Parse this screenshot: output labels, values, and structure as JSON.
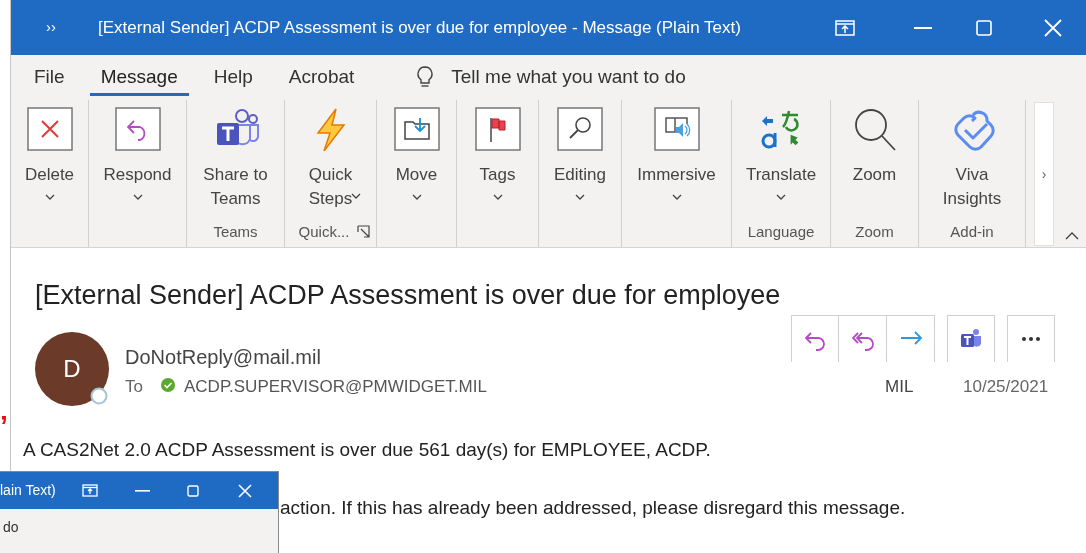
{
  "window": {
    "title": "[External Sender] ACDP Assessment is over due for employee  -  Message (Plain Text)",
    "overflow_glyph": "››"
  },
  "menu": [
    {
      "label": "File",
      "selected": false
    },
    {
      "label": "Message",
      "selected": true
    },
    {
      "label": "Help",
      "selected": false
    },
    {
      "label": "Acrobat",
      "selected": false
    }
  ],
  "tell_me": {
    "placeholder": "Tell me what you want to do"
  },
  "ribbon": {
    "groups": [
      {
        "buttons": [
          {
            "kind": "delete",
            "label": "Delete",
            "dropdown": true
          }
        ]
      },
      {
        "buttons": [
          {
            "kind": "respond",
            "label": "Respond",
            "dropdown": true
          }
        ]
      },
      {
        "label": "Teams",
        "buttons": [
          {
            "kind": "teams",
            "label": "Share to Teams",
            "dropdown": false
          }
        ]
      },
      {
        "label": "Quick...",
        "launcher": true,
        "buttons": [
          {
            "kind": "quicksteps",
            "label": "Quick Steps",
            "dropdown": true
          }
        ]
      },
      {
        "buttons": [
          {
            "kind": "move",
            "label": "Move",
            "dropdown": true
          }
        ]
      },
      {
        "buttons": [
          {
            "kind": "tags",
            "label": "Tags",
            "dropdown": true
          }
        ]
      },
      {
        "buttons": [
          {
            "kind": "editing",
            "label": "Editing",
            "dropdown": true
          }
        ]
      },
      {
        "buttons": [
          {
            "kind": "immersive",
            "label": "Immersive",
            "dropdown": true
          }
        ]
      },
      {
        "label": "Language",
        "buttons": [
          {
            "kind": "translate",
            "label": "Translate",
            "dropdown": true
          }
        ]
      },
      {
        "label": "Zoom",
        "buttons": [
          {
            "kind": "zoom",
            "label": "Zoom",
            "dropdown": false
          }
        ]
      },
      {
        "label": "Add-in",
        "buttons": [
          {
            "kind": "viva",
            "label": "Viva Insights",
            "dropdown": false
          }
        ]
      }
    ],
    "scroll_glyph": "›"
  },
  "message": {
    "subject": "[External Sender] ACDP Assessment is over due for employee",
    "avatar_initial": "D",
    "sender": "DoNotReply@mail.mil",
    "to_label": "To",
    "recipient": "ACDP.SUPERVISOR@PMWIDGET.MIL",
    "actions": [
      {
        "kind": "reply"
      },
      {
        "kind": "reply_all"
      },
      {
        "kind": "forward"
      },
      {
        "kind": "teams"
      },
      {
        "kind": "more"
      }
    ],
    "organization": "MIL",
    "date": "10/25/2021",
    "body": [
      "A CAS2Net 2.0 ACDP Assessment is over due 561 day(s) for EMPLOYEE, ACDP.",
      "action. If this has already been addressed, please disregard this message."
    ]
  },
  "margin_mark": "”",
  "second_window": {
    "title": "lain Text)",
    "menu_text": "do"
  }
}
